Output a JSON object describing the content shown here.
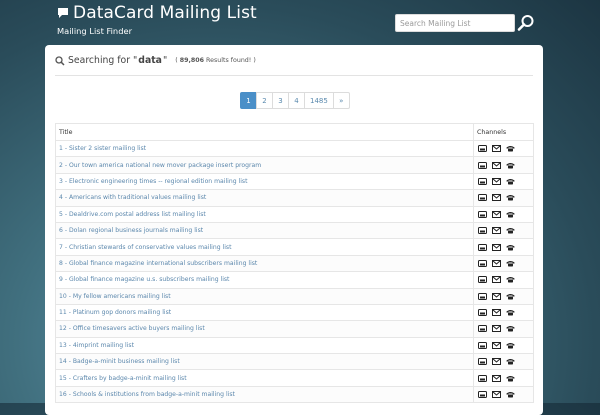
{
  "header": {
    "title": "DataCard Mailing List",
    "subtitle": "Mailing List Finder",
    "search_placeholder": "Search Mailing List"
  },
  "results": {
    "heading_prefix": "Searching for \"",
    "term": "data",
    "heading_suffix": "\"",
    "count_open": "( ",
    "count": "89,806",
    "count_tail": " Results found! )"
  },
  "pagination": [
    "1",
    "2",
    "3",
    "4",
    "1485",
    "»"
  ],
  "table": {
    "col_title": "Title",
    "col_channels": "Channels",
    "rows": [
      "1 - Sister 2 sister mailing list",
      "2 - Our town america national new mover package insert program",
      "3 - Electronic engineering times -- regional edition mailing list",
      "4 - Americans with traditional values mailing list",
      "5 - Dealdrive.com postal address list mailing list",
      "6 - Dolan regional business journals mailing list",
      "7 - Christian stewards of conservative values mailing list",
      "8 - Global finance magazine international subscribers mailing list",
      "9 - Global finance magazine u.s. subscribers mailing list",
      "10 - My fellow americans mailing list",
      "11 - Platinum gop donors mailing list",
      "12 - Office timesavers active buyers mailing list",
      "13 - 4imprint mailing list",
      "14 - Badge-a-minit business mailing list",
      "15 - Crafters by badge-a-minit mailing list",
      "16 - Schools & institutions from badge-a-minit mailing list"
    ],
    "channel_icons": [
      "postal-mail-icon",
      "email-icon",
      "phone-icon"
    ]
  },
  "colors": {
    "accent": "#4a8fc8",
    "link": "#5b87ac",
    "background_dark": "#1c3542"
  }
}
